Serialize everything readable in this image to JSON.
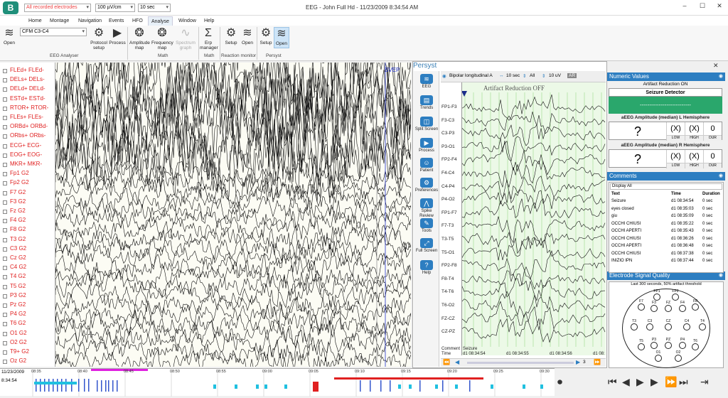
{
  "window": {
    "title": "EEG - John Full Hd - 11/23/2009 8:34:54 AM",
    "logo": "B",
    "electrodes_combo": "All recorded electrodes",
    "sensitivity_combo": "100 µV/cm",
    "timebase_combo": "10 sec",
    "minimize": "–",
    "maximize": "☐",
    "close": "✕"
  },
  "menu": [
    "Home",
    "Montage",
    "Navigation",
    "Events",
    "HFO",
    "Analyse",
    "Window",
    "Help"
  ],
  "ribbon": {
    "open": "Open",
    "cfm_combo": "CFM C3-C4",
    "protocol_setup": "Protocol setup",
    "process": "Process",
    "amplitude_map": "Amplitude map",
    "frequency_map": "Frequency map",
    "spectrum_graph": "Spectrum graph",
    "erp_manager": "Erp manager",
    "rm_setup": "Setup",
    "rm_open": "Open",
    "ps_setup": "Setup",
    "ps_open": "Open",
    "groups": [
      "EEG Analyser",
      "Math",
      "Math",
      "Reaction monitor",
      "Persyst"
    ]
  },
  "channels": [
    "FLEd+ FLEd-",
    "DELs+ DELs-",
    "DELd+ DELd-",
    "ESTd+ ESTd-",
    "RTOR+ RTOR-",
    "FLEs+ FLEs-",
    "ORBd+ ORBd-",
    "ORbs+ ORbs-",
    "ECG+ ECG-",
    "EOG+ EOG-",
    "MKR+ MKR-",
    "Fp1 G2",
    "Fp2 G2",
    "F7 G2",
    "F3 G2",
    "Fz G2",
    "F4 G2",
    "F8 G2",
    "T3 G2",
    "C3 G2",
    "Cz G2",
    "C4 G2",
    "T4 G2",
    "T5 G2",
    "P3 G2",
    "Pz G2",
    "P4 G2",
    "T6 G2",
    "O1 G2",
    "O2 G2",
    "T9+ G2",
    "Oz G2"
  ],
  "main_marker": "SVEP",
  "persyst": {
    "title": "Persyst",
    "nav": [
      "EEG",
      "Trends",
      "Split Screen",
      "Process",
      "Patient",
      "Preferences",
      "Spike Review",
      "Tools",
      "Full Screen",
      "Help"
    ],
    "montage": "Bipolar longitudinal A",
    "timebase": "10 sec",
    "channels_all": "All",
    "sensitivity": "10 uV",
    "artifact_label": "Artifact Reduction OFF",
    "channels": [
      "FP1-F3",
      "F3-C3",
      "C3-P3",
      "P3-O1",
      "FP2-F4",
      "F4-C4",
      "C4-P4",
      "P4-O2",
      "FP1-F7",
      "F7-T3",
      "T3-T5",
      "T5-O1",
      "FP2-F8",
      "F8-T4",
      "T4-T6",
      "T6-O2",
      "FZ-CZ",
      "CZ-PZ"
    ],
    "footer": {
      "comment_lbl": "Comment",
      "time_lbl": "Time",
      "seizure": "Seizure",
      "t0": "d1 08:34:54",
      "t1": "d1 08:34:55",
      "t2": "d1 08:34:56",
      "t3": "d1 08:"
    },
    "page": "3"
  },
  "numeric": {
    "title": "Numeric Values",
    "artifact_on": "Artifact Reduction ON",
    "seizure_detector": "Seizure Detector",
    "seizure_box": "---------------------------",
    "left_title": "aEEG Amplitude (median) L Hemisphere",
    "right_title": "aEEG Amplitude (median) R Hemisphere",
    "q": "?",
    "x": "(X)",
    "zero": "0",
    "low": "LOW",
    "high": "HIGH",
    "dur": "DUR"
  },
  "comments": {
    "title": "Comments",
    "filter": "Display All",
    "headers": [
      "Text",
      "Time",
      "Duration"
    ],
    "rows": [
      [
        "Seizure",
        "d1 08:34:54",
        "0 sec"
      ],
      [
        "eyes closed",
        "d1 08:35:03",
        "0 sec"
      ],
      [
        "giu",
        "d1 08:35:09",
        "0 sec"
      ],
      [
        "OCCHI CHIUSI",
        "d1 08:35:22",
        "0 sec"
      ],
      [
        "OCCHI APERTI",
        "d1 08:35:43",
        "0 sec"
      ],
      [
        "OCCHI CHIUSI",
        "d1 08:36:26",
        "0 sec"
      ],
      [
        "OCCHI APERTI",
        "d1 08:36:48",
        "0 sec"
      ],
      [
        "OCCHI CHIUSI",
        "d1 08:37:38",
        "0 sec"
      ],
      [
        "INIZIO IPN",
        "d1 08:37:44",
        "0 sec"
      ]
    ]
  },
  "esq": {
    "title": "Electrode Signal Quality",
    "subtitle": "Last 300 seconds, 50% artifact threshold",
    "electrodes": [
      "FP1",
      "FP2",
      "F7",
      "F3",
      "FZ",
      "F4",
      "F8",
      "T3",
      "C3",
      "CZ",
      "C4",
      "T4",
      "T5",
      "P3",
      "PZ",
      "P4",
      "T6",
      "O1",
      "O2"
    ]
  },
  "timeline": {
    "date": "11/23/2009",
    "time": "8:34:54",
    "ticks": [
      "08:35",
      "08:40",
      "08:45",
      "08:50",
      "08:55",
      "09:00",
      "09:05",
      "09:10",
      "09:15",
      "09:20",
      "09:25",
      "09:30"
    ]
  }
}
